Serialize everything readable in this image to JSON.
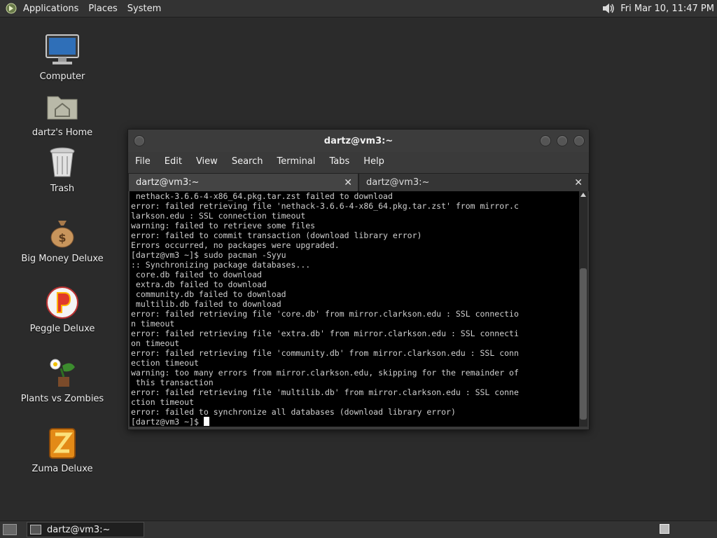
{
  "top_panel": {
    "menus": [
      "Applications",
      "Places",
      "System"
    ],
    "clock": "Fri Mar 10, 11:47 PM",
    "logo_icon": "gnome-foot-icon",
    "volume_icon": "speaker-icon"
  },
  "desktop_icons": [
    {
      "label": "Computer",
      "icon": "computer-icon"
    },
    {
      "label": "dartz's Home",
      "icon": "home-folder-icon"
    },
    {
      "label": "Trash",
      "icon": "trash-icon"
    },
    {
      "label": "Big Money Deluxe",
      "icon": "money-bag-icon"
    },
    {
      "label": "Peggle Deluxe",
      "icon": "peggle-icon"
    },
    {
      "label": "Plants vs Zombies",
      "icon": "plants-zombies-icon"
    },
    {
      "label": "Zuma Deluxe",
      "icon": "zuma-icon"
    }
  ],
  "terminal": {
    "title": "dartz@vm3:~",
    "menus": [
      "File",
      "Edit",
      "View",
      "Search",
      "Terminal",
      "Tabs",
      "Help"
    ],
    "tabs": [
      {
        "label": "dartz@vm3:~",
        "active": true
      },
      {
        "label": "dartz@vm3:~",
        "active": false
      }
    ],
    "lines": [
      " nethack-3.6.6-4-x86_64.pkg.tar.zst failed to download",
      "error: failed retrieving file 'nethack-3.6.6-4-x86_64.pkg.tar.zst' from mirror.c",
      "larkson.edu : SSL connection timeout",
      "warning: failed to retrieve some files",
      "error: failed to commit transaction (download library error)",
      "Errors occurred, no packages were upgraded.",
      "[dartz@vm3 ~]$ sudo pacman -Syyu",
      ":: Synchronizing package databases...",
      " core.db failed to download",
      " extra.db failed to download",
      " community.db failed to download",
      " multilib.db failed to download",
      "error: failed retrieving file 'core.db' from mirror.clarkson.edu : SSL connectio",
      "n timeout",
      "error: failed retrieving file 'extra.db' from mirror.clarkson.edu : SSL connecti",
      "on timeout",
      "error: failed retrieving file 'community.db' from mirror.clarkson.edu : SSL conn",
      "ection timeout",
      "warning: too many errors from mirror.clarkson.edu, skipping for the remainder of",
      " this transaction",
      "error: failed retrieving file 'multilib.db' from mirror.clarkson.edu : SSL conne",
      "ction timeout",
      "error: failed to synchronize all databases (download library error)"
    ],
    "prompt": "[dartz@vm3 ~]$ "
  },
  "bottom_panel": {
    "task_label": "dartz@vm3:~"
  },
  "colors": {
    "desktop_bg": "#2b2b2b",
    "panel_bg": "#333333",
    "terminal_bg": "#000000",
    "terminal_fg": "#d0d0d0"
  }
}
